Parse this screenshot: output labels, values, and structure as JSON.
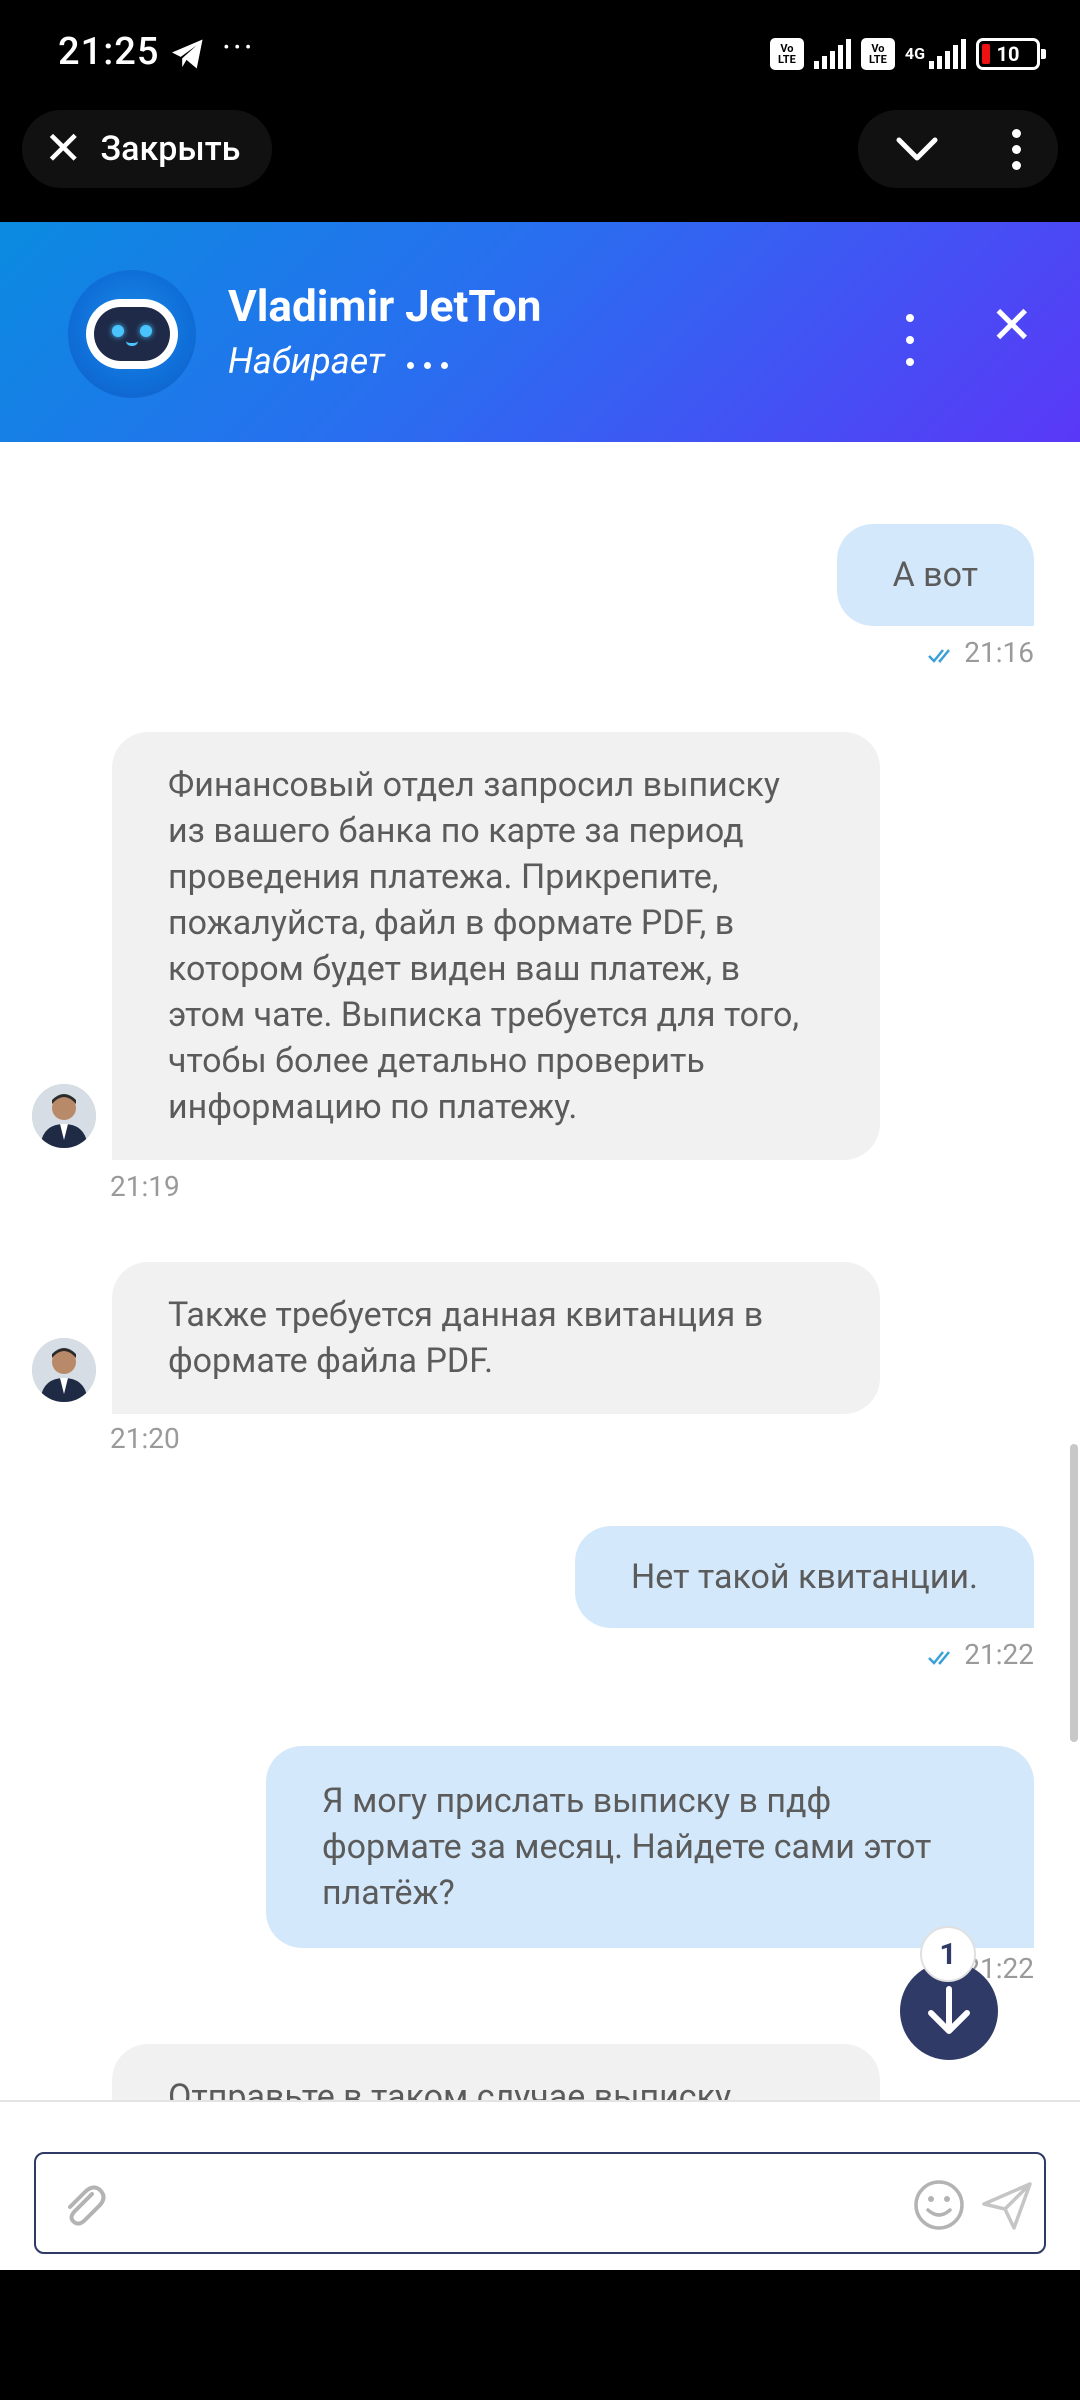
{
  "status_bar": {
    "time": "21:25",
    "net1": "Vo LTE",
    "net2": "Vo LTE",
    "net_type": "4G",
    "battery": "10"
  },
  "browser": {
    "close_label": "Закрыть"
  },
  "chat_header": {
    "name": "Vladimir JetTon",
    "status": "Набирает"
  },
  "messages": [
    {
      "dir": "out",
      "text": "А вот",
      "time": "21:16"
    },
    {
      "dir": "in",
      "text": "Финансовый отдел запросил выписку из вашего банка по карте за период проведения платежа. Прикрепите, пожалуйста, файл в формате PDF, в котором будет виден ваш платеж, в этом чате. Выписка требуется для того, чтобы более детально проверить информацию по платежу.",
      "time": "21:19"
    },
    {
      "dir": "in",
      "text": "Также требуется данная квитанция в формате файла PDF.",
      "time": "21:20"
    },
    {
      "dir": "out",
      "text": "Нет такой квитанции.",
      "time": "21:22"
    },
    {
      "dir": "out",
      "text": "Я могу прислать выписку в пдф формате за месяц. Найдете сами этот платёж?",
      "time": "21:22"
    },
    {
      "dir": "in",
      "text": "Отправьте в таком случае выписку",
      "time": ""
    }
  ],
  "unread_count": "1",
  "composer": {
    "placeholder": ""
  },
  "colors": {
    "header_start": "#0a8be0",
    "header_end": "#5a38f7",
    "outgoing_bubble": "#d4e8fb",
    "incoming_bubble": "#f1f1f1",
    "fab": "#2f3a66"
  }
}
